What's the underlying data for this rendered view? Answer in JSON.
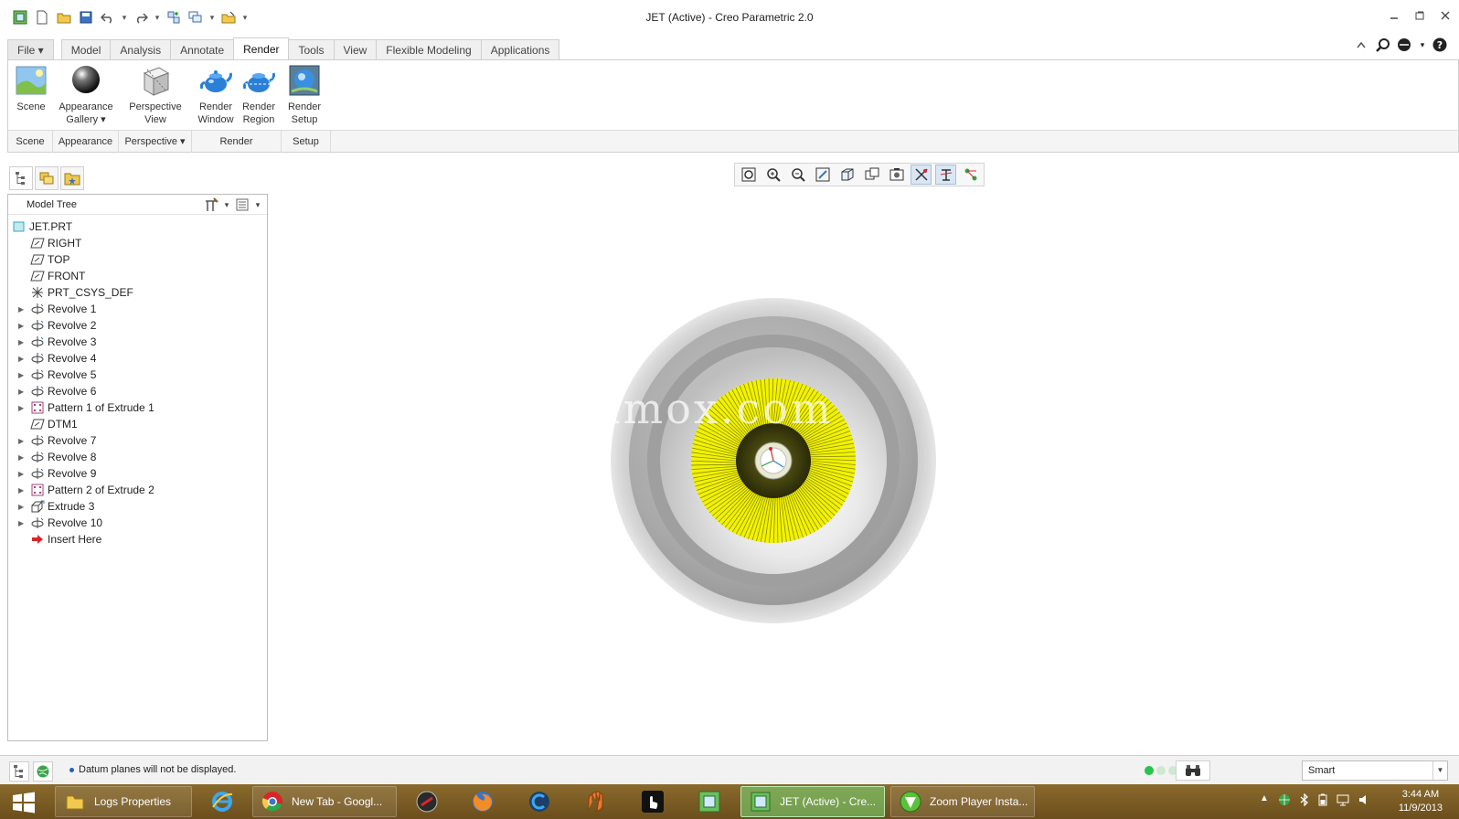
{
  "window": {
    "title": "JET (Active) - Creo Parametric 2.0"
  },
  "ribbon_tabs": [
    {
      "label": "File ▾"
    },
    {
      "label": "Model"
    },
    {
      "label": "Analysis"
    },
    {
      "label": "Annotate"
    },
    {
      "label": "Render"
    },
    {
      "label": "Tools"
    },
    {
      "label": "View"
    },
    {
      "label": "Flexible Modeling"
    },
    {
      "label": "Applications"
    }
  ],
  "ribbon": {
    "buttons": {
      "scene": "Scene",
      "appearance_1": "Appearance",
      "appearance_2": "Gallery ▾",
      "perspective_1": "Perspective",
      "perspective_2": "View",
      "render_window_1": "Render",
      "render_window_2": "Window",
      "render_region_1": "Render",
      "render_region_2": "Region",
      "render_setup_1": "Render",
      "render_setup_2": "Setup"
    },
    "groups": {
      "scene": "Scene",
      "appearance": "Appearance",
      "perspective": "Perspective ▾",
      "render": "Render",
      "setup": "Setup"
    }
  },
  "model_tree": {
    "title": "Model Tree",
    "items": [
      {
        "label": "JET.PRT"
      },
      {
        "label": "RIGHT"
      },
      {
        "label": "TOP"
      },
      {
        "label": "FRONT"
      },
      {
        "label": "PRT_CSYS_DEF"
      },
      {
        "label": "Revolve 1"
      },
      {
        "label": "Revolve 2"
      },
      {
        "label": "Revolve 3"
      },
      {
        "label": "Revolve 4"
      },
      {
        "label": "Revolve 5"
      },
      {
        "label": "Revolve 6"
      },
      {
        "label": "Pattern 1 of Extrude 1"
      },
      {
        "label": "DTM1"
      },
      {
        "label": "Revolve 7"
      },
      {
        "label": "Revolve 8"
      },
      {
        "label": "Revolve 9"
      },
      {
        "label": "Pattern 2 of Extrude 2"
      },
      {
        "label": "Extrude 3"
      },
      {
        "label": "Revolve 10"
      },
      {
        "label": "Insert Here"
      }
    ]
  },
  "graphics": {
    "watermark": "ww.3dmox.com"
  },
  "status": {
    "message": "Datum planes will not be displayed.",
    "filter": "Smart"
  },
  "taskbar": {
    "items": {
      "explorer": "Logs Properties",
      "chrome": "New Tab - Googl...",
      "creo": "JET (Active) - Cre...",
      "zoomplayer": "Zoom Player Insta..."
    },
    "clock_time": "3:44 AM",
    "clock_date": "11/9/2013"
  },
  "colors": {
    "accent": "#2f6bbf",
    "model_fan": "#f2f200",
    "taskbar": "#7a5a24"
  }
}
